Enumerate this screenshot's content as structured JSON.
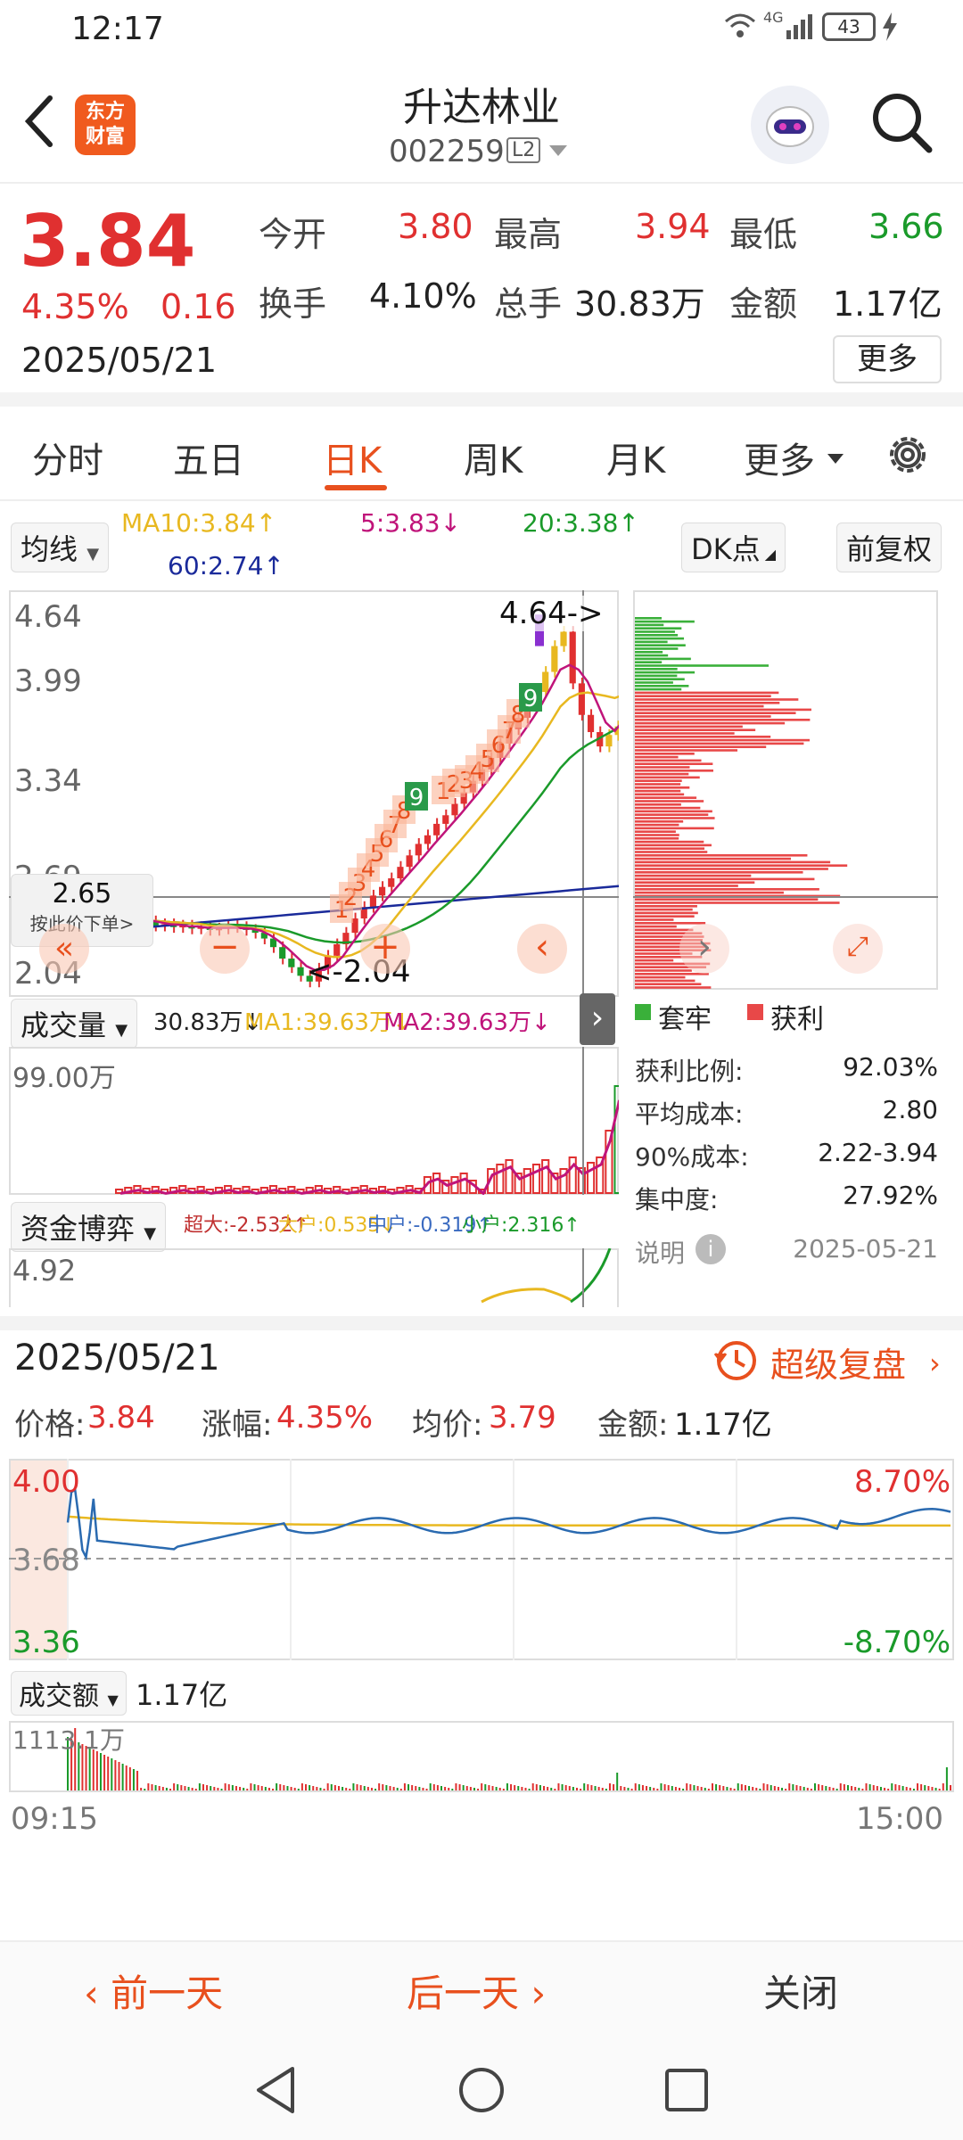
{
  "status_bar": {
    "time": "12:17",
    "network": "4G",
    "battery": "43"
  },
  "header": {
    "title": "升达林业",
    "code": "002259",
    "level_badge": "L2",
    "logo_text_1": "东方",
    "logo_text_2": "财富"
  },
  "quote": {
    "price": "3.84",
    "change_pct": "4.35%",
    "change": "0.16",
    "date": "2025/05/21",
    "fields": [
      {
        "label": "今开",
        "value": "3.80"
      },
      {
        "label": "最高",
        "value": "3.94"
      },
      {
        "label": "最低",
        "value": "3.66"
      },
      {
        "label": "换手",
        "value": "4.10%"
      },
      {
        "label": "总手",
        "value": "30.83万"
      },
      {
        "label": "金额",
        "value": "1.17亿"
      }
    ],
    "more_label": "更多"
  },
  "tabs": [
    "分时",
    "五日",
    "日K",
    "周K",
    "月K",
    "更多"
  ],
  "indicators": {
    "ma_selector": "均线",
    "ma10": "MA10:3.84↑",
    "ma5": "5:3.83↓",
    "ma20": "20:3.38↑",
    "ma60": "60:2.74↑",
    "dk_label": "DK点",
    "adjust_label": "前复权"
  },
  "kline": {
    "y_labels": [
      "4.64",
      "3.99",
      "3.34",
      "2.69",
      "2.04"
    ],
    "high_marker": "4.64->",
    "low_marker": "<-2.04",
    "crosshair_price": "2.65",
    "crosshair_hint": "按此价下单>",
    "td_numbers": [
      "1",
      "2",
      "3",
      "4",
      "5",
      "6",
      "7",
      "8",
      "9",
      "1",
      "2",
      "3",
      "4",
      "5",
      "6",
      "7",
      "8",
      "9"
    ],
    "colors": {
      "up": "#e03030",
      "down": "#1a9a2a",
      "ma5": "#c0147a",
      "ma10": "#e8b820",
      "ma20": "#1a9a2a",
      "ma60": "#1a2a9a"
    }
  },
  "volume": {
    "selector": "成交量",
    "value": "30.83万↓",
    "ma1": "MA1:39.63万↓",
    "ma2": "MA2:39.63万↓",
    "max_label": "99.00万"
  },
  "capital": {
    "selector": "资金博弈",
    "super": "超大:-2.532↑",
    "big": "大户:0.535↓",
    "mid": "中户:-0.319↑",
    "small": "小户:2.316↑",
    "value": "4.92"
  },
  "chip": {
    "legend_trapped": "套牢",
    "legend_profit": "获利",
    "rows": [
      {
        "label": "获利比例:",
        "value": "92.03%"
      },
      {
        "label": "平均成本:",
        "value": "2.80"
      },
      {
        "label": "90%成本:",
        "value": "2.22-3.94"
      },
      {
        "label": "集中度:",
        "value": "27.92%"
      }
    ],
    "note_label": "说明",
    "note_date": "2025-05-21"
  },
  "detail": {
    "date": "2025/05/21",
    "replay_label": "超级复盘",
    "price_label": "价格:",
    "price": "3.84",
    "pct_label": "涨幅:",
    "pct": "4.35%",
    "avg_label": "均价:",
    "avg": "3.79",
    "amt_label": "金额:",
    "amt": "1.17亿",
    "y_top": "4.00",
    "y_mid": "3.68",
    "y_bottom": "3.36",
    "pct_top": "8.70%",
    "pct_bottom": "-8.70%",
    "amount_selector": "成交额",
    "amount_value": "1.17亿",
    "amount_max": "1113.1万",
    "time_start": "09:15",
    "time_end": "15:00"
  },
  "bottom_bar": {
    "prev": "前一天",
    "next": "后一天",
    "close": "关闭"
  }
}
